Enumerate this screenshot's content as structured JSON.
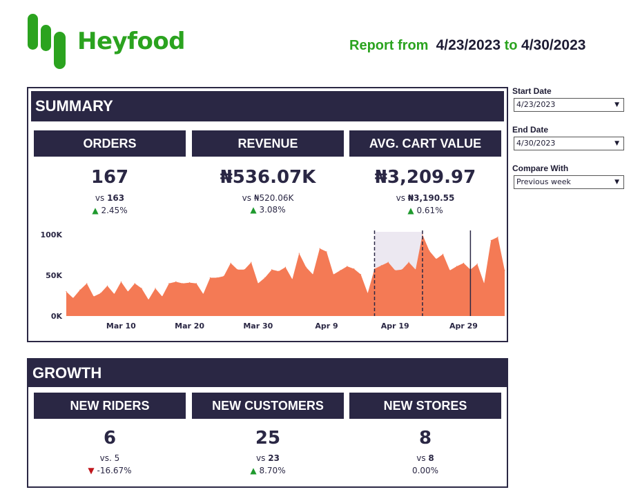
{
  "brand": {
    "name": "Heyfood",
    "color": "#2ba31f"
  },
  "report": {
    "prefix": "Report from",
    "start": "4/23/2023",
    "connector": "to",
    "end": "4/30/2023"
  },
  "filters": {
    "start_date": {
      "label": "Start Date",
      "value": "4/23/2023"
    },
    "end_date": {
      "label": "End Date",
      "value": "4/30/2023"
    },
    "compare": {
      "label": "Compare With",
      "value": "Previous week"
    }
  },
  "summary": {
    "title": "SUMMARY",
    "kpis": [
      {
        "label": "ORDERS",
        "value": "167",
        "vs_prefix": "vs",
        "vs_value": "163",
        "change": "2.45%",
        "direction": "up"
      },
      {
        "label": "REVENUE",
        "value": "₦536.07K",
        "vs_prefix": "vs",
        "vs_value": "₦520.06K",
        "change": "3.08%",
        "direction": "up"
      },
      {
        "label": "AVG. CART VALUE",
        "value": "₦3,209.97",
        "vs_prefix": "vs",
        "vs_value": "₦3,190.55",
        "change": "0.61%",
        "direction": "up"
      }
    ]
  },
  "growth": {
    "title": "GROWTH",
    "kpis": [
      {
        "label": "NEW RIDERS",
        "value": "6",
        "vs_prefix": "vs.",
        "vs_value": "5",
        "change": "-16.67%",
        "direction": "down"
      },
      {
        "label": "NEW CUSTOMERS",
        "value": "25",
        "vs_prefix": "vs",
        "vs_value": "23",
        "change": "8.70%",
        "direction": "up"
      },
      {
        "label": "NEW STORES",
        "value": "8",
        "vs_prefix": "vs",
        "vs_value": "8",
        "change": "0.00%",
        "direction": "none"
      }
    ]
  },
  "chart_data": {
    "type": "area",
    "color": "#f47a55",
    "highlight_color": "#ece8f1",
    "y_ticks": [
      "0K",
      "50K",
      "100K"
    ],
    "ylim": [
      0,
      100000
    ],
    "x_start": "2023-03-02",
    "x_ticks": [
      {
        "label": "Mar 10",
        "date": "2023-03-10"
      },
      {
        "label": "Mar 20",
        "date": "2023-03-20"
      },
      {
        "label": "Mar 30",
        "date": "2023-03-30"
      },
      {
        "label": "Apr 9",
        "date": "2023-04-09"
      },
      {
        "label": "Apr 19",
        "date": "2023-04-19"
      },
      {
        "label": "Apr 29",
        "date": "2023-04-29"
      }
    ],
    "values": [
      30000,
      22000,
      32000,
      40000,
      24000,
      28000,
      37000,
      27000,
      42000,
      30000,
      40000,
      34000,
      20000,
      34000,
      24000,
      40000,
      42000,
      40000,
      41000,
      40000,
      27000,
      47000,
      47000,
      49000,
      65000,
      57000,
      57000,
      66000,
      40000,
      47000,
      57000,
      55000,
      60000,
      45000,
      77000,
      60000,
      51000,
      83000,
      79000,
      51000,
      56000,
      61000,
      58000,
      51000,
      28000,
      58000,
      62000,
      66000,
      56000,
      57000,
      66000,
      57000,
      100000,
      80000,
      70000,
      76000,
      56000,
      61000,
      65000,
      57000,
      64000,
      40000,
      93000,
      97000,
      56000
    ],
    "highlight_range": [
      "2023-04-16",
      "2023-04-23"
    ],
    "dashed_markers": [
      "2023-04-16",
      "2023-04-23"
    ],
    "solid_marker": "2023-04-30"
  }
}
